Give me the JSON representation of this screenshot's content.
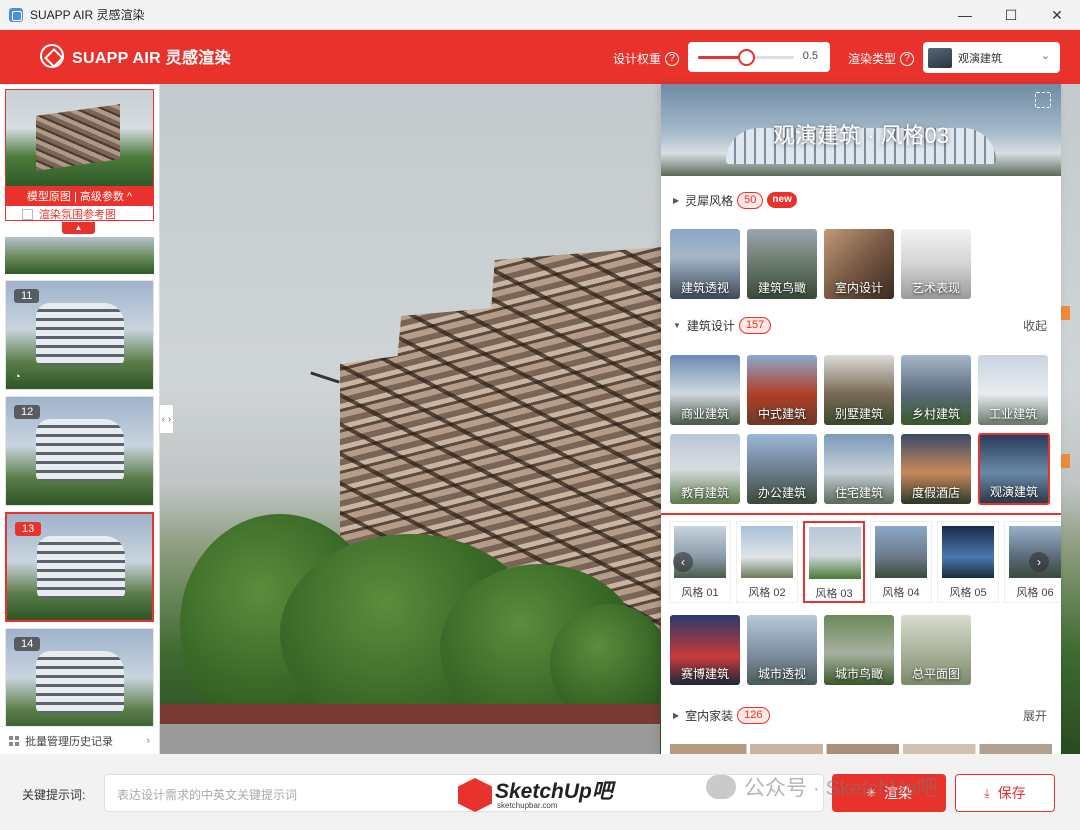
{
  "window": {
    "title": "SUAPP AIR 灵感渲染",
    "controls": {
      "minimize": "—",
      "maximize": "☐",
      "close": "✕"
    }
  },
  "header": {
    "brand": "SUAPP AIR 灵感渲染",
    "weight_label": "设计权重",
    "weight_value": "0.5",
    "weight_fraction": 0.5,
    "type_label": "渲染类型",
    "type_selected": "观演建筑",
    "accent_color": "#e8322b"
  },
  "sidebar": {
    "original_bar": "模型原图 | 高级参数 ^",
    "original_check_label": "渲染氛围参考图",
    "collapse_arrow": "▲",
    "history": [
      {
        "num": "11",
        "active": false
      },
      {
        "num": "12",
        "active": false
      },
      {
        "num": "13",
        "active": true
      },
      {
        "num": "14",
        "active": false
      }
    ],
    "batch_label": "批量管理历史记录",
    "batch_arrow": "›"
  },
  "canvas": {
    "collapse_handle": "‹ ›"
  },
  "panel": {
    "hero_title": "观演建筑 · 风格03",
    "sections": {
      "lingxi": {
        "label": "灵犀风格",
        "count": "50",
        "badge": "new"
      },
      "arch": {
        "label": "建筑设计",
        "count": "157",
        "action": "收起"
      },
      "interior": {
        "label": "室内家装",
        "count": "126",
        "action": "展开"
      }
    },
    "lingxi_tiles": [
      "建筑透视",
      "建筑鸟瞰",
      "室内设计",
      "艺术表现"
    ],
    "arch_tiles_row1": [
      "商业建筑",
      "中式建筑",
      "别墅建筑",
      "乡村建筑",
      "工业建筑"
    ],
    "arch_tiles_row2": [
      "教育建筑",
      "办公建筑",
      "住宅建筑",
      "度假酒店",
      "观演建筑"
    ],
    "arch_selected": "观演建筑",
    "styles": [
      "风格 01",
      "风格 02",
      "风格 03",
      "风格 04",
      "风格 05",
      "风格 06"
    ],
    "style_selected": "风格 03",
    "carousel_prev": "‹",
    "carousel_next": "›",
    "arch_tiles_row3": [
      "赛博建筑",
      "城市透视",
      "城市鸟瞰",
      "总平面图"
    ]
  },
  "bottom": {
    "keyword_label": "关键提示词:",
    "keyword_placeholder": "表达设计需求的中英文关键提示词",
    "render_label": "渲染",
    "render_icon": "✳",
    "save_label": "保存",
    "save_icon": "⤓"
  },
  "watermarks": {
    "sketchup_logo": "SketchUp吧",
    "sketchup_site": "sketchupbar.com",
    "wechat": "公众号 · SketchUp吧"
  }
}
